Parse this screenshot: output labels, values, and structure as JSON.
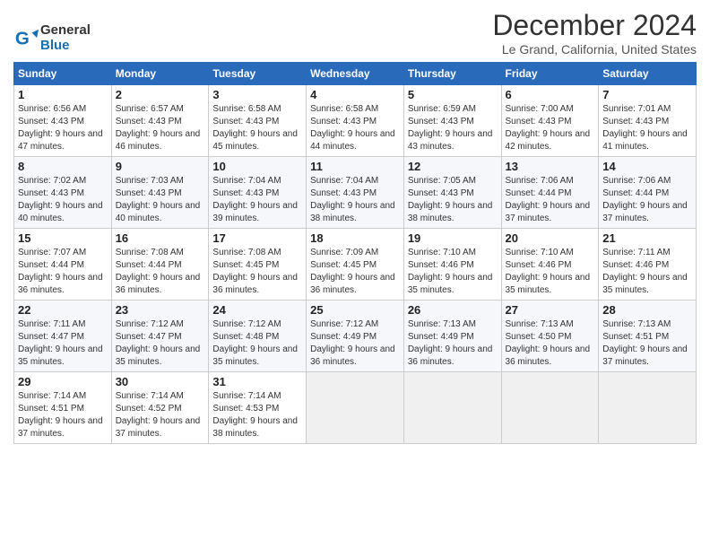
{
  "header": {
    "logo_line1": "General",
    "logo_line2": "Blue",
    "month_title": "December 2024",
    "location": "Le Grand, California, United States"
  },
  "columns": [
    "Sunday",
    "Monday",
    "Tuesday",
    "Wednesday",
    "Thursday",
    "Friday",
    "Saturday"
  ],
  "weeks": [
    [
      {
        "day": "1",
        "sunrise": "6:56 AM",
        "sunset": "4:43 PM",
        "daylight": "9 hours and 47 minutes."
      },
      {
        "day": "2",
        "sunrise": "6:57 AM",
        "sunset": "4:43 PM",
        "daylight": "9 hours and 46 minutes."
      },
      {
        "day": "3",
        "sunrise": "6:58 AM",
        "sunset": "4:43 PM",
        "daylight": "9 hours and 45 minutes."
      },
      {
        "day": "4",
        "sunrise": "6:58 AM",
        "sunset": "4:43 PM",
        "daylight": "9 hours and 44 minutes."
      },
      {
        "day": "5",
        "sunrise": "6:59 AM",
        "sunset": "4:43 PM",
        "daylight": "9 hours and 43 minutes."
      },
      {
        "day": "6",
        "sunrise": "7:00 AM",
        "sunset": "4:43 PM",
        "daylight": "9 hours and 42 minutes."
      },
      {
        "day": "7",
        "sunrise": "7:01 AM",
        "sunset": "4:43 PM",
        "daylight": "9 hours and 41 minutes."
      }
    ],
    [
      {
        "day": "8",
        "sunrise": "7:02 AM",
        "sunset": "4:43 PM",
        "daylight": "9 hours and 40 minutes."
      },
      {
        "day": "9",
        "sunrise": "7:03 AM",
        "sunset": "4:43 PM",
        "daylight": "9 hours and 40 minutes."
      },
      {
        "day": "10",
        "sunrise": "7:04 AM",
        "sunset": "4:43 PM",
        "daylight": "9 hours and 39 minutes."
      },
      {
        "day": "11",
        "sunrise": "7:04 AM",
        "sunset": "4:43 PM",
        "daylight": "9 hours and 38 minutes."
      },
      {
        "day": "12",
        "sunrise": "7:05 AM",
        "sunset": "4:43 PM",
        "daylight": "9 hours and 38 minutes."
      },
      {
        "day": "13",
        "sunrise": "7:06 AM",
        "sunset": "4:44 PM",
        "daylight": "9 hours and 37 minutes."
      },
      {
        "day": "14",
        "sunrise": "7:06 AM",
        "sunset": "4:44 PM",
        "daylight": "9 hours and 37 minutes."
      }
    ],
    [
      {
        "day": "15",
        "sunrise": "7:07 AM",
        "sunset": "4:44 PM",
        "daylight": "9 hours and 36 minutes."
      },
      {
        "day": "16",
        "sunrise": "7:08 AM",
        "sunset": "4:44 PM",
        "daylight": "9 hours and 36 minutes."
      },
      {
        "day": "17",
        "sunrise": "7:08 AM",
        "sunset": "4:45 PM",
        "daylight": "9 hours and 36 minutes."
      },
      {
        "day": "18",
        "sunrise": "7:09 AM",
        "sunset": "4:45 PM",
        "daylight": "9 hours and 36 minutes."
      },
      {
        "day": "19",
        "sunrise": "7:10 AM",
        "sunset": "4:46 PM",
        "daylight": "9 hours and 35 minutes."
      },
      {
        "day": "20",
        "sunrise": "7:10 AM",
        "sunset": "4:46 PM",
        "daylight": "9 hours and 35 minutes."
      },
      {
        "day": "21",
        "sunrise": "7:11 AM",
        "sunset": "4:46 PM",
        "daylight": "9 hours and 35 minutes."
      }
    ],
    [
      {
        "day": "22",
        "sunrise": "7:11 AM",
        "sunset": "4:47 PM",
        "daylight": "9 hours and 35 minutes."
      },
      {
        "day": "23",
        "sunrise": "7:12 AM",
        "sunset": "4:47 PM",
        "daylight": "9 hours and 35 minutes."
      },
      {
        "day": "24",
        "sunrise": "7:12 AM",
        "sunset": "4:48 PM",
        "daylight": "9 hours and 35 minutes."
      },
      {
        "day": "25",
        "sunrise": "7:12 AM",
        "sunset": "4:49 PM",
        "daylight": "9 hours and 36 minutes."
      },
      {
        "day": "26",
        "sunrise": "7:13 AM",
        "sunset": "4:49 PM",
        "daylight": "9 hours and 36 minutes."
      },
      {
        "day": "27",
        "sunrise": "7:13 AM",
        "sunset": "4:50 PM",
        "daylight": "9 hours and 36 minutes."
      },
      {
        "day": "28",
        "sunrise": "7:13 AM",
        "sunset": "4:51 PM",
        "daylight": "9 hours and 37 minutes."
      }
    ],
    [
      {
        "day": "29",
        "sunrise": "7:14 AM",
        "sunset": "4:51 PM",
        "daylight": "9 hours and 37 minutes."
      },
      {
        "day": "30",
        "sunrise": "7:14 AM",
        "sunset": "4:52 PM",
        "daylight": "9 hours and 37 minutes."
      },
      {
        "day": "31",
        "sunrise": "7:14 AM",
        "sunset": "4:53 PM",
        "daylight": "9 hours and 38 minutes."
      },
      null,
      null,
      null,
      null
    ]
  ]
}
